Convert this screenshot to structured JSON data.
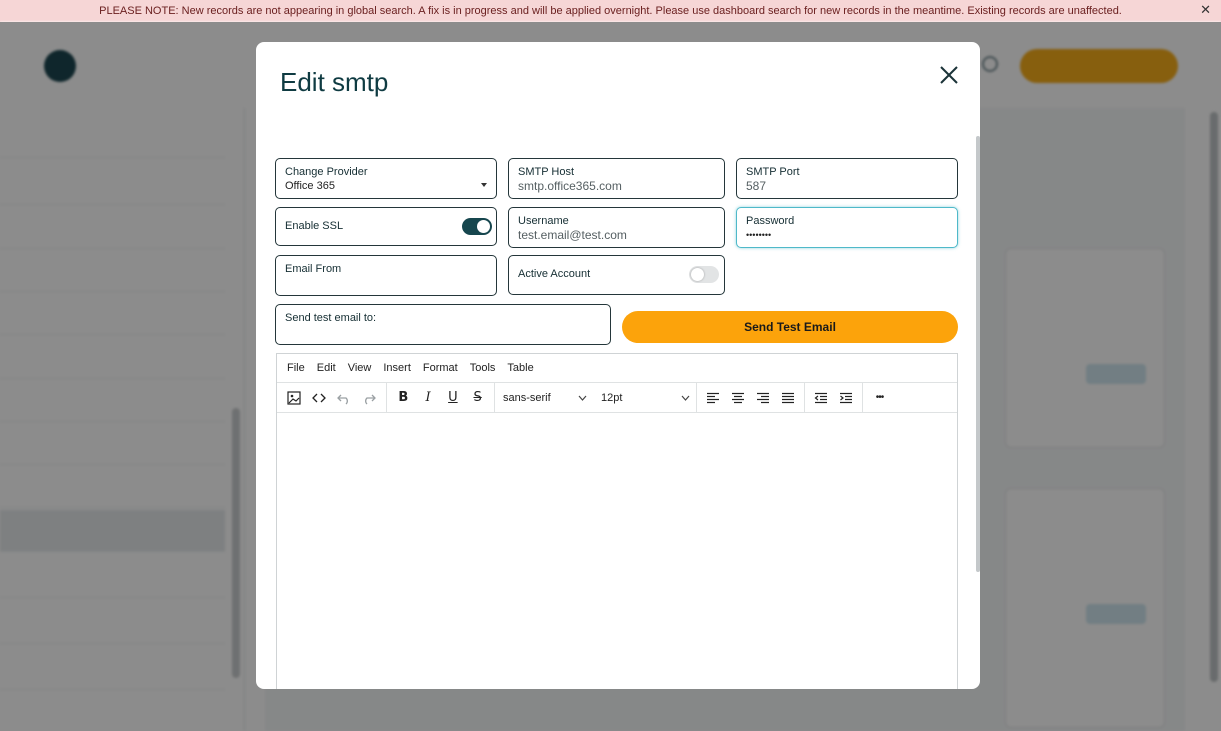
{
  "notice": {
    "text": "PLEASE NOTE: New records are not appearing in global search. A fix is in progress and will be applied overnight. Please use dashboard search for new records in the meantime. Existing records are unaffected.",
    "close_glyph": "✕"
  },
  "modal": {
    "title": "Edit smtp",
    "close_glyph": "close-icon"
  },
  "form": {
    "provider": {
      "label": "Change Provider",
      "value": "Office 365"
    },
    "host": {
      "label": "SMTP Host",
      "value": "smtp.office365.com"
    },
    "port": {
      "label": "SMTP Port",
      "value": "587"
    },
    "ssl": {
      "label": "Enable SSL",
      "enabled": true
    },
    "username": {
      "label": "Username",
      "value": "test.email@test.com"
    },
    "password": {
      "label": "Password",
      "value": "••••••••"
    },
    "email_from": {
      "label": "Email From",
      "value": ""
    },
    "active": {
      "label": "Active Account",
      "enabled": false
    },
    "test_email": {
      "label": "Send test email to:",
      "value": ""
    },
    "send_button": "Send Test Email"
  },
  "editor": {
    "menu": [
      "File",
      "Edit",
      "View",
      "Insert",
      "Format",
      "Tools",
      "Table"
    ],
    "font_family": "sans-serif",
    "font_size": "12pt",
    "more_glyph": "•••"
  },
  "colors": {
    "accent": "#fca30b",
    "toggle_on": "#16464e",
    "focus_border": "#4fb9c9",
    "notice_bg": "#f6d6d6"
  }
}
